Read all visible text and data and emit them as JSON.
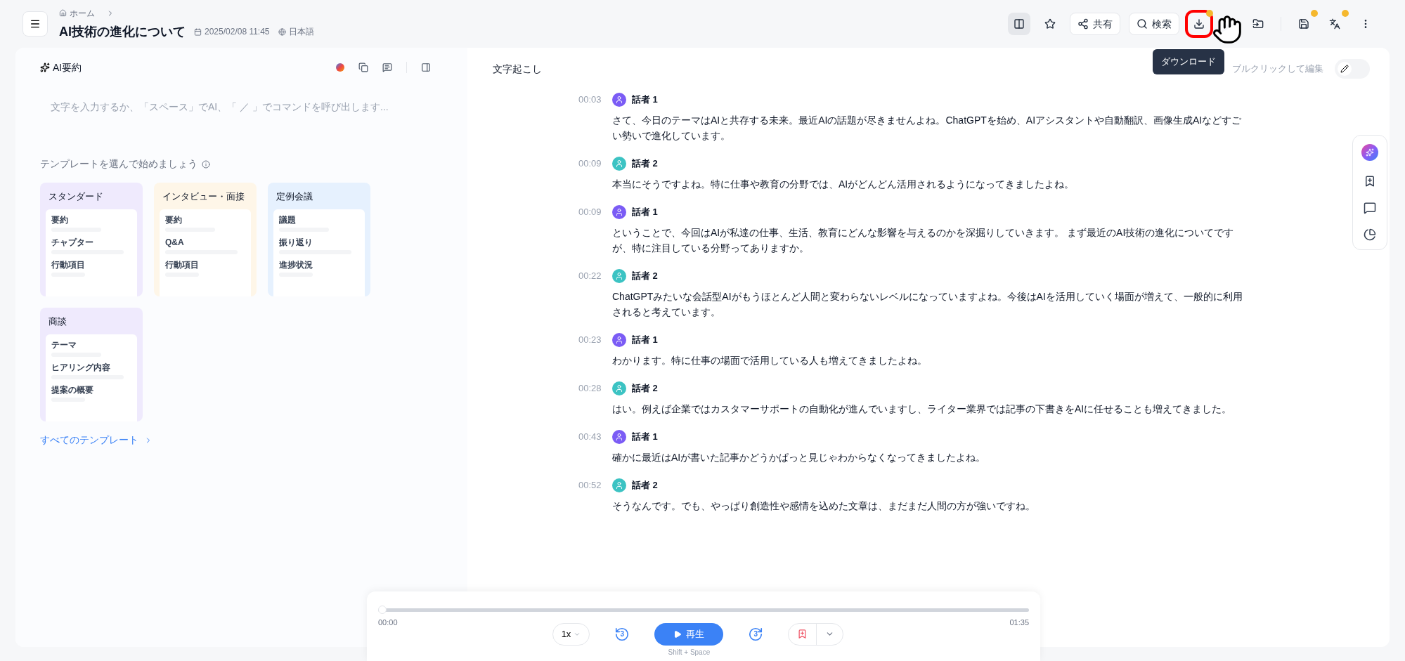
{
  "header": {
    "breadcrumb": "ホーム",
    "title": "AI技術の進化について",
    "date": "2025/02/08 11:45",
    "language": "日本語",
    "toolbar": [
      {
        "kind": "icon",
        "selected": true
      },
      {
        "kind": "icon",
        "selected": false
      },
      {
        "kind": "text",
        "label": "共有",
        "selected": false
      },
      {
        "kind": "text",
        "label": "検索",
        "selected": false
      },
      {
        "kind": "icon",
        "selected": false,
        "highlighted": true,
        "badge": true
      },
      {
        "kind": "icon",
        "selected": false
      },
      {
        "kind": "divider"
      },
      {
        "kind": "icon",
        "selected": false,
        "badge": true
      },
      {
        "kind": "icon",
        "selected": false,
        "badge": true
      },
      {
        "kind": "icon",
        "selected": false
      }
    ],
    "tooltip": "ダウンロード"
  },
  "summary": {
    "title": "AI要約",
    "placeholder": "文字を入力するか、「スペース」でAI、「 ／ 」でコマンドを呼び出します...",
    "templates_heading": "テンプレートを選んで始めましょう",
    "templates": [
      {
        "name": "スタンダード",
        "color": "#efeafd",
        "items": [
          "要約",
          "チャプター",
          "行動項目"
        ]
      },
      {
        "name": "インタビュー・面接",
        "color": "#fef6e8",
        "items": [
          "要約",
          "Q&A",
          "行動項目"
        ]
      },
      {
        "name": "定例会議",
        "color": "#e6f1fe",
        "items": [
          "議題",
          "振り返り",
          "進捗状況"
        ]
      },
      {
        "name": "商談",
        "color": "#efeafd",
        "items": [
          "テーマ",
          "ヒアリング内容",
          "提案の概要"
        ]
      }
    ],
    "all_templates": "すべてのテンプレート"
  },
  "transcript": {
    "title": "文字起こし",
    "hint": "ブルクリックして編集",
    "edit_mode": false,
    "segments": [
      {
        "time": "00:03",
        "speaker": "話者 1",
        "color": "#7b5cf5",
        "text": "さて、今日のテーマはAIと共存する未来。最近AIの話題が尽きませんよね。ChatGPTを始め、AIアシスタントや自動翻訳、画像生成AIなどすごい勢いで進化しています。"
      },
      {
        "time": "00:09",
        "speaker": "話者 2",
        "color": "#3cc3c3",
        "text": "本当にそうですよね。特に仕事や教育の分野では、AIがどんどん活用されるようになってきましたよね。"
      },
      {
        "time": "00:09",
        "speaker": "話者 1",
        "color": "#7b5cf5",
        "text": "ということで、今回はAIが私達の仕事、生活、教育にどんな影響を与えるのかを深掘りしていきます。 まず最近のAI技術の進化についてですが、特に注目している分野ってありますか。"
      },
      {
        "time": "00:22",
        "speaker": "話者 2",
        "color": "#3cc3c3",
        "text": "ChatGPTみたいな会話型AIがもうほとんど人間と変わらないレベルになっていますよね。今後はAIを活用していく場面が増えて、一般的に利用されると考えています。"
      },
      {
        "time": "00:23",
        "speaker": "話者 1",
        "color": "#7b5cf5",
        "text": "わかります。特に仕事の場面で活用している人も増えてきましたよね。"
      },
      {
        "time": "00:28",
        "speaker": "話者 2",
        "color": "#3cc3c3",
        "text": "はい。例えば企業ではカスタマーサポートの自動化が進んでいますし、ライター業界では記事の下書きをAIに任せることも増えてきました。"
      },
      {
        "time": "00:43",
        "speaker": "話者 1",
        "color": "#7b5cf5",
        "text": "確かに最近はAIが書いた記事かどうかぱっと見じゃわからなくなってきましたよね。"
      },
      {
        "time": "00:52",
        "speaker": "話者 2",
        "color": "#3cc3c3",
        "text": "そうなんです。でも、やっぱり創造性や感情を込めた文章は、まだまだ人間の方が強いですね。"
      }
    ]
  },
  "player": {
    "level": 0,
    "current": "00:00",
    "duration": "01:35",
    "speed": "1x",
    "skip_back": "3",
    "play": "再生",
    "shortcut": "Shift + Space",
    "skip_forward": "3"
  }
}
